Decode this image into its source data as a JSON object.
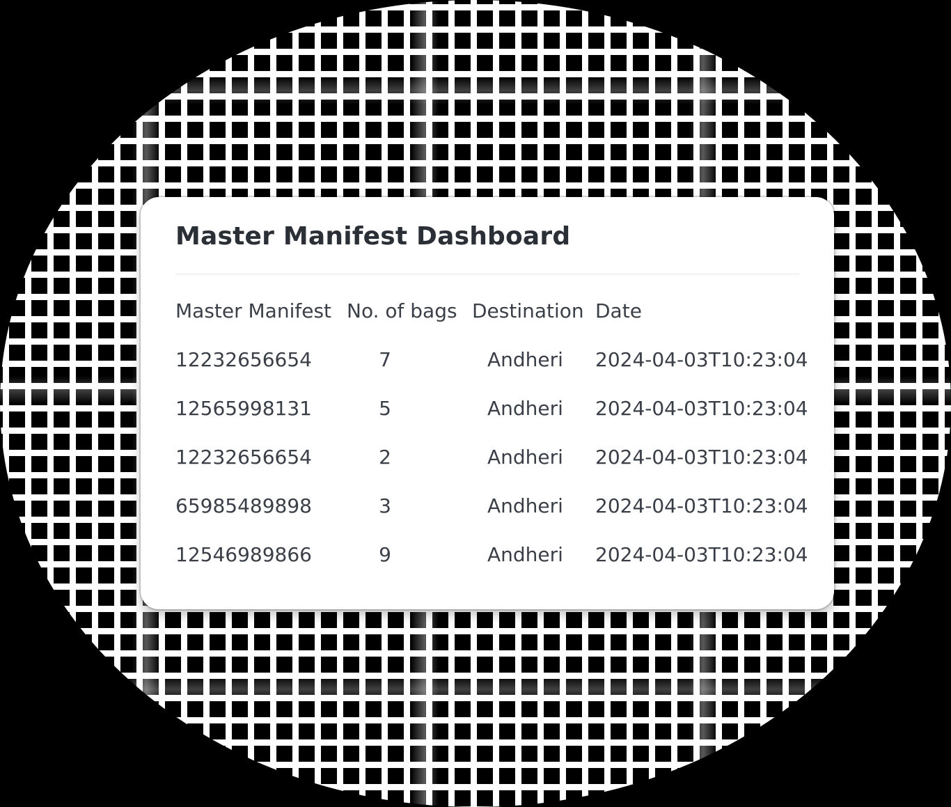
{
  "card": {
    "title": "Master Manifest Dashboard"
  },
  "table": {
    "columns": [
      "Master Manifest",
      "No. of bags",
      "Destination",
      "Date"
    ],
    "rows": [
      {
        "manifest": "12232656654",
        "bags": "7",
        "destination": "Andheri",
        "date": "2024-04-03T10:23:04"
      },
      {
        "manifest": "12565998131",
        "bags": "5",
        "destination": "Andheri",
        "date": "2024-04-03T10:23:04"
      },
      {
        "manifest": "12232656654",
        "bags": "2",
        "destination": "Andheri",
        "date": "2024-04-03T10:23:04"
      },
      {
        "manifest": "65985489898",
        "bags": "3",
        "destination": "Andheri",
        "date": "2024-04-03T10:23:04"
      },
      {
        "manifest": "12546989866",
        "bags": "9",
        "destination": "Andheri",
        "date": "2024-04-03T10:23:04"
      }
    ]
  },
  "colors": {
    "background": "#000000",
    "grid": "#ffffff",
    "card": "#ffffff",
    "text": "#3a3f47",
    "title": "#2b2f36"
  }
}
